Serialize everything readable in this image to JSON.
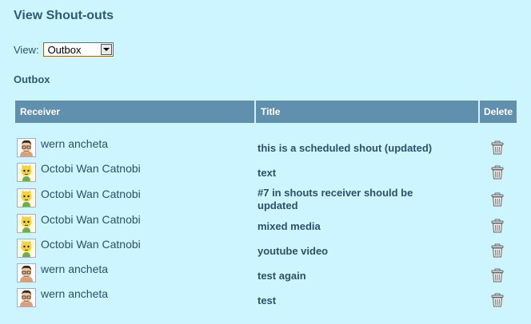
{
  "page": {
    "title": "View Shout-outs"
  },
  "view": {
    "label": "View:",
    "selected": "Outbox"
  },
  "section_title": "Outbox",
  "table": {
    "columns": {
      "receiver": "Receiver",
      "title": "Title",
      "delete": "Delete"
    },
    "rows": [
      {
        "receiver": "wern ancheta",
        "avatar": "man-avatar-icon",
        "title": "this is a scheduled shout (updated)"
      },
      {
        "receiver": "Octobi Wan Catnobi",
        "avatar": "octocat-avatar-icon",
        "title": "text"
      },
      {
        "receiver": "Octobi Wan Catnobi",
        "avatar": "octocat-avatar-icon",
        "title": "#7 in shouts receiver should be updated"
      },
      {
        "receiver": "Octobi Wan Catnobi",
        "avatar": "octocat-avatar-icon",
        "title": "mixed media"
      },
      {
        "receiver": "Octobi Wan Catnobi",
        "avatar": "octocat-avatar-icon",
        "title": "youtube video"
      },
      {
        "receiver": "wern ancheta",
        "avatar": "man-avatar-icon",
        "title": "test again"
      },
      {
        "receiver": "wern ancheta",
        "avatar": "man-avatar-icon",
        "title": "test"
      }
    ]
  },
  "colors": {
    "background": "#ccf5ff",
    "header": "#6090ad",
    "text": "#2e5068"
  }
}
